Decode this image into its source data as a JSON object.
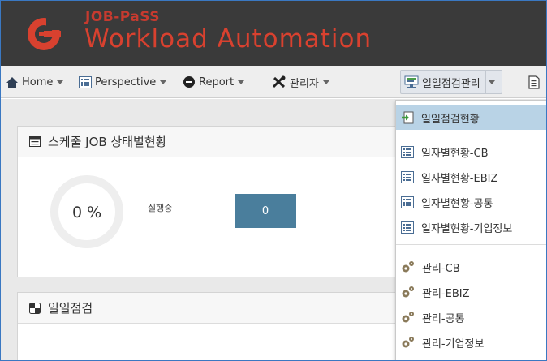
{
  "brand": {
    "line1": "JOB-PaSS",
    "line2": "Workload Automation"
  },
  "menubar": {
    "items": [
      {
        "label": "Home",
        "icon": "home-icon"
      },
      {
        "label": "Perspective",
        "icon": "list-icon"
      },
      {
        "label": "Report",
        "icon": "minus-circle-icon"
      },
      {
        "label": "관리자",
        "icon": "tools-icon"
      },
      {
        "label": "일일점검관리",
        "icon": "monitor-icon"
      },
      {
        "label": "",
        "icon": "document-icon"
      }
    ]
  },
  "panels": {
    "schedule": {
      "title": "스케줄 JOB 상태별현황",
      "gauge_value": "0 %",
      "running_label": "실행중",
      "running_count": "0"
    },
    "daily_check": {
      "title": "일일점검"
    }
  },
  "dropdown": {
    "items": [
      {
        "label": "일일점검현황",
        "icon": "enter-icon",
        "highlighted": true
      },
      {
        "label": "일자별현황-CB",
        "icon": "list-icon"
      },
      {
        "label": "일자별현황-EBIZ",
        "icon": "list-icon"
      },
      {
        "label": "일자별현황-공통",
        "icon": "list-icon"
      },
      {
        "label": "일자별현황-기업정보",
        "icon": "list-icon"
      },
      {
        "label": "관리-CB",
        "icon": "gears-icon"
      },
      {
        "label": "관리-EBIZ",
        "icon": "gears-icon"
      },
      {
        "label": "관리-공통",
        "icon": "gears-icon"
      },
      {
        "label": "관리-기업정보",
        "icon": "gears-icon"
      }
    ]
  },
  "colors": {
    "header_bg": "#3a3a3a",
    "brand_red": "#d8412f",
    "accent_button": "#4a7e9c",
    "highlight": "#b9d3e6"
  }
}
